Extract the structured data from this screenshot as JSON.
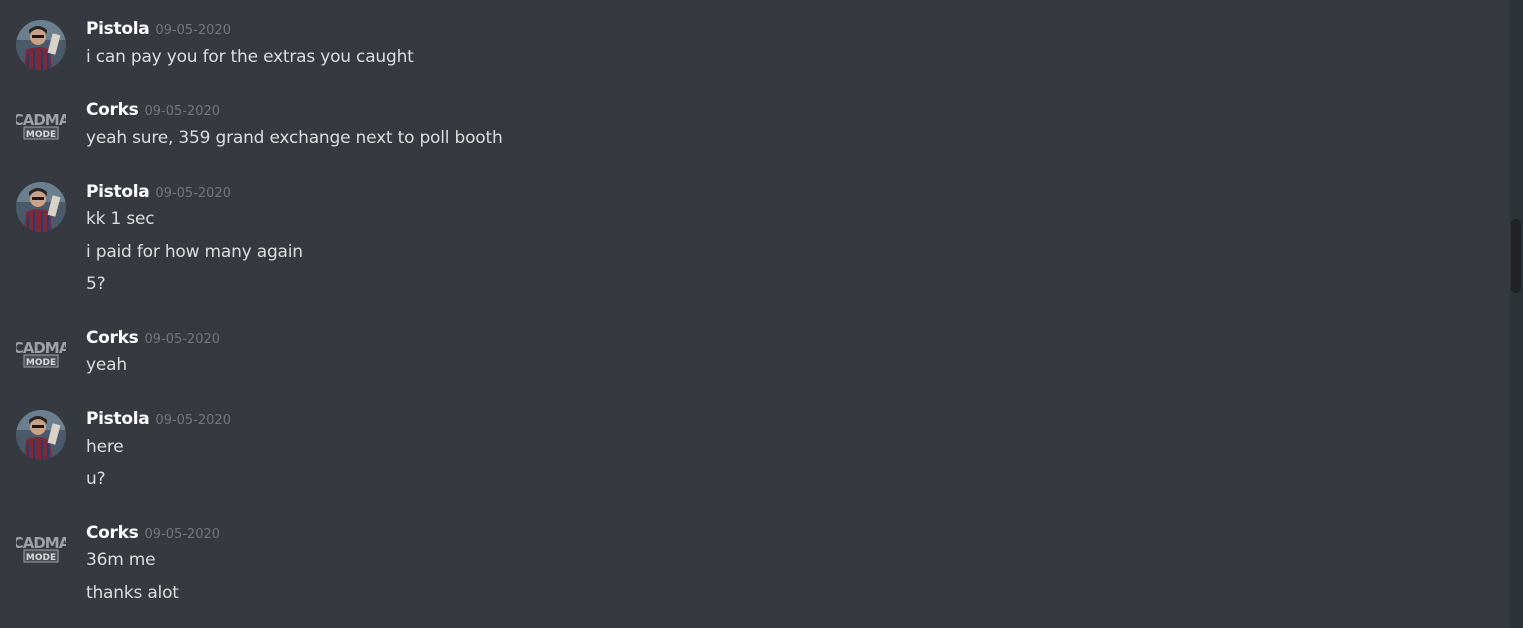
{
  "messages": [
    {
      "author": "Pistola",
      "avatar": "pistola-avatar",
      "timestamp": "09-05-2020",
      "lines": [
        "i can pay you for the extras you caught"
      ]
    },
    {
      "author": "Corks",
      "avatar": "cadma-mode-avatar",
      "timestamp": "09-05-2020",
      "lines": [
        "yeah sure, 359 grand exchange next to poll booth"
      ]
    },
    {
      "author": "Pistola",
      "avatar": "pistola-avatar",
      "timestamp": "09-05-2020",
      "lines": [
        "kk 1 sec",
        "i paid for how many again",
        "5?"
      ]
    },
    {
      "author": "Corks",
      "avatar": "cadma-mode-avatar",
      "timestamp": "09-05-2020",
      "lines": [
        "yeah"
      ]
    },
    {
      "author": "Pistola",
      "avatar": "pistola-avatar",
      "timestamp": "09-05-2020",
      "lines": [
        "here",
        "u?"
      ]
    },
    {
      "author": "Corks",
      "avatar": "cadma-mode-avatar",
      "timestamp": "09-05-2020",
      "lines": [
        "36m me",
        "thanks alot"
      ]
    }
  ],
  "logo_text": {
    "cadma_top": "CADMA",
    "cadma_bottom": "MODE"
  },
  "colors": {
    "background": "#36393f",
    "username": "#ffffff",
    "message_text": "#dcddde",
    "timestamp": "#72767d"
  }
}
